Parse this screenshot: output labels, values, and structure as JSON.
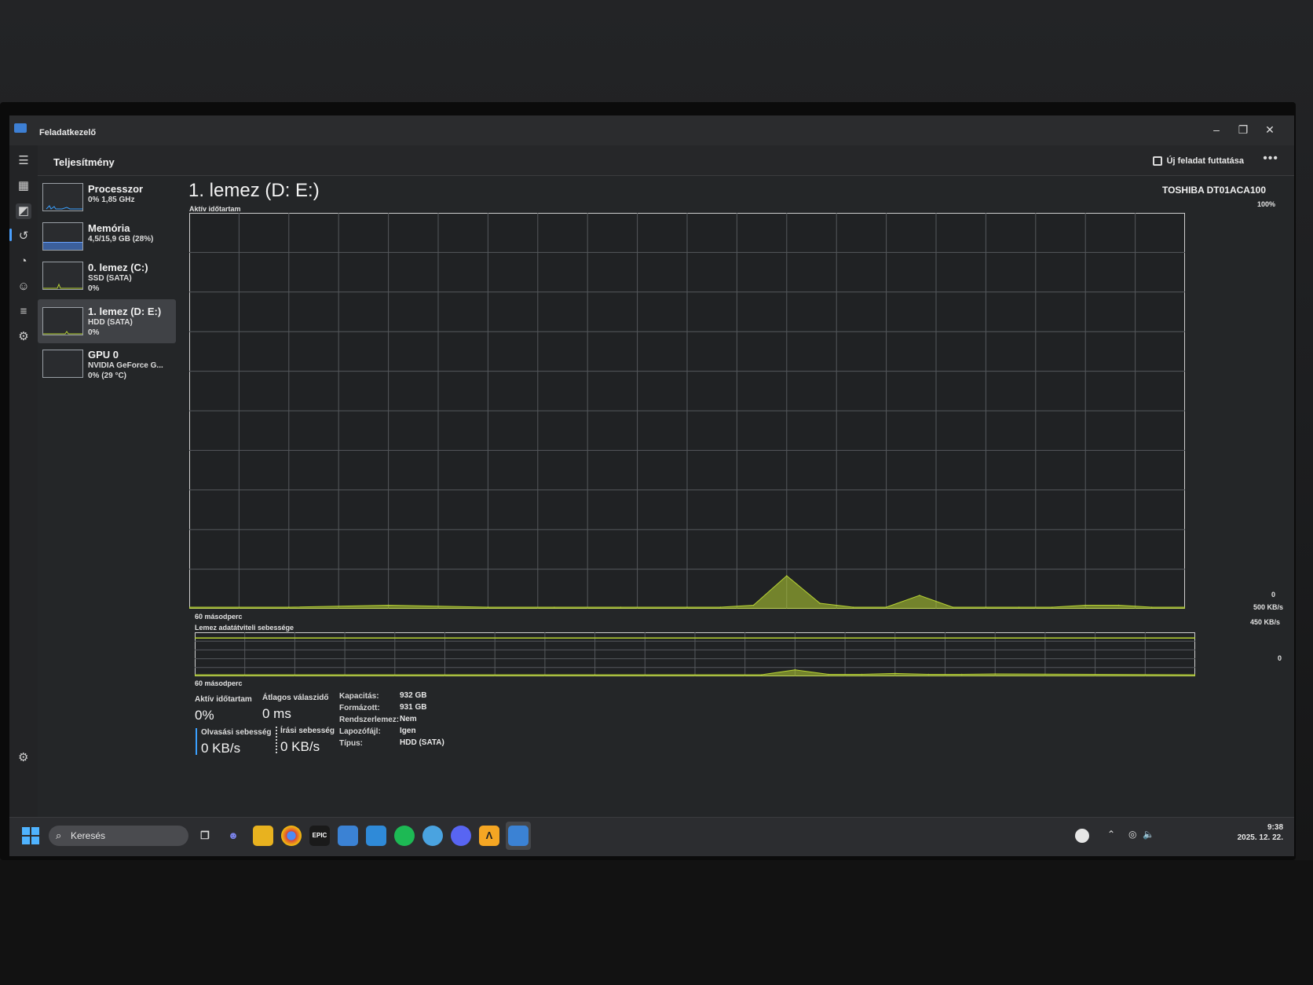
{
  "window": {
    "title": "Feladatkezelő"
  },
  "header": {
    "page_title": "Teljesítmény",
    "run_task_label": "Új feladat futtatása",
    "more_label": "•••"
  },
  "sidebar": {
    "tiles": [
      {
        "name": "Processzor",
        "sub1": "0% 1,85 GHz",
        "sub2": ""
      },
      {
        "name": "Memória",
        "sub1": "4,5/15,9 GB (28%)",
        "sub2": ""
      },
      {
        "name": "0. lemez (C:)",
        "sub1": "SSD (SATA)",
        "sub2": "0%"
      },
      {
        "name": "1. lemez (D: E:)",
        "sub1": "HDD (SATA)",
        "sub2": "0%"
      },
      {
        "name": "GPU 0",
        "sub1": "NVIDIA GeForce G...",
        "sub2": "0% (29 °C)"
      }
    ]
  },
  "main": {
    "title": "1. lemez (D: E:)",
    "model": "TOSHIBA DT01ACA100",
    "active_chart": {
      "label": "Aktív időtartam",
      "max_label": "100%",
      "min_label": "0",
      "time_label": "60 másodperc"
    },
    "transfer_chart": {
      "label": "Lemez adatátviteli sebessége",
      "max_label": "500 KB/s",
      "line_label": "450 KB/s",
      "min_label": "0",
      "time_label": "60 másodperc"
    }
  },
  "chart_data": [
    {
      "type": "area",
      "title": "Aktív időtartam",
      "xlabel": "60 másodperc",
      "ylabel": "",
      "ylim": [
        0,
        100
      ],
      "x": [
        60,
        54,
        48,
        42,
        38,
        34,
        30,
        28,
        26,
        24,
        22,
        20,
        18,
        16,
        14,
        12,
        10,
        8,
        6,
        4,
        2,
        0
      ],
      "values": [
        0,
        0,
        0.5,
        0,
        0,
        0,
        0,
        0,
        0.5,
        8,
        1,
        0,
        0,
        3,
        0,
        0,
        0,
        0,
        0.5,
        0.5,
        0,
        0
      ],
      "grid": true,
      "color": "#b8d433"
    },
    {
      "type": "area",
      "title": "Lemez adatátviteli sebessége",
      "xlabel": "60 másodperc",
      "ylabel": "",
      "ylim": [
        0,
        500
      ],
      "x": [
        60,
        36,
        26,
        24,
        22,
        20,
        18,
        16,
        14,
        12,
        0
      ],
      "values": [
        0,
        0,
        0,
        60,
        5,
        5,
        15,
        5,
        5,
        10,
        0
      ],
      "reference_line": 450,
      "grid": true,
      "color": "#b8d433"
    }
  ],
  "stats": {
    "active_time": {
      "label": "Aktív időtartam",
      "value": "0%"
    },
    "avg_response": {
      "label": "Átlagos válaszidő",
      "value": "0 ms"
    },
    "read_speed": {
      "label": "Olvasási sebesség",
      "value": "0 KB/s"
    },
    "write_speed": {
      "label": "Írási sebesség",
      "value": "0 KB/s"
    },
    "properties": [
      {
        "key": "Kapacitás:",
        "value": "932 GB"
      },
      {
        "key": "Formázott:",
        "value": "931 GB"
      },
      {
        "key": "Rendszerlemez:",
        "value": "Nem"
      },
      {
        "key": "Lapozófájl:",
        "value": "Igen"
      },
      {
        "key": "Típus:",
        "value": "HDD (SATA)"
      }
    ]
  },
  "taskbar": {
    "search_placeholder": "Keresés",
    "time": "9:38",
    "date": "2025. 12. 22."
  },
  "colors": {
    "accent": "#b8d433",
    "active_rail": "#4aa0ff",
    "read_bar": "#3aa0ff"
  }
}
